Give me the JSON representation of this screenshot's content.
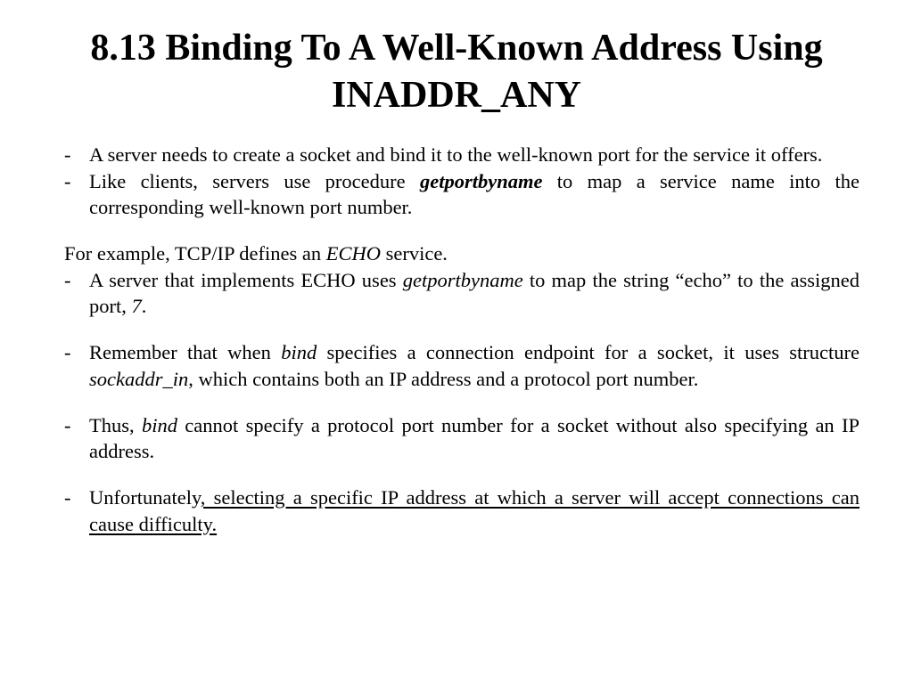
{
  "title": "8.13 Binding To A Well-Known Address Using INADDR_ANY",
  "b1a": "A server needs to create a socket and bind it to the well-known port for the service it offers.",
  "b2a": "Like clients, servers use procedure ",
  "b2b": "getportbyname",
  "b2c": " to map a service name into the corresponding well-known port number.",
  "p3a": "For example, TCP/IP defines an ",
  "p3b": "ECHO",
  "p3c": " service.",
  "b4a": "A server that implements ECHO uses ",
  "b4b": "getportbyname",
  "b4c": " to map the string “echo” to the assigned port, ",
  "b4d": "7",
  "b4e": ".",
  "b5a": "Remember that when ",
  "b5b": "bind",
  "b5c": " specifies a connection endpoint for a socket, it uses structure ",
  "b5d": "sockaddr_in",
  "b5e": ", which contains both an IP address and a protocol port number.",
  "b6a": "Thus, ",
  "b6b": "bind",
  "b6c": " cannot specify a protocol port number for a socket without also specifying an IP address.",
  "b7a": "Unfortunately",
  "b7b": ", selecting a specific IP address at which a server will accept connections can cause difficulty."
}
